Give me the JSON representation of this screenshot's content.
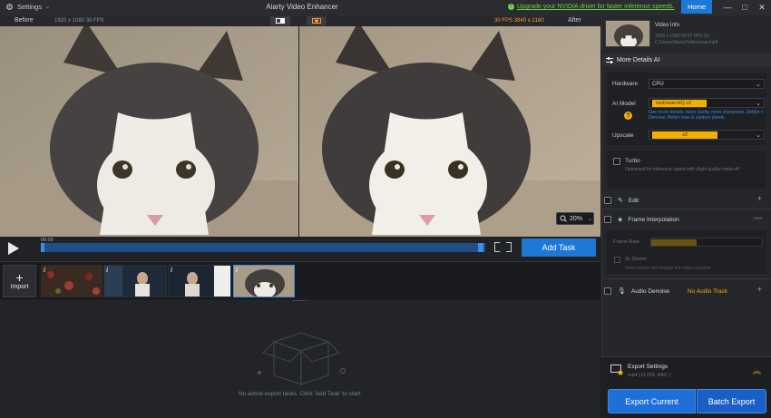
{
  "titlebar": {
    "settings_label": "Settings",
    "app_title": "Aiarty Video Enhancer",
    "upgrade_text": "Upgrade your NVIDIA driver for faster inference speeds.",
    "home_label": "Home",
    "minimize": "—",
    "maximize": "□",
    "close": "✕"
  },
  "compare": {
    "before_label": "Before",
    "before_meta": "1920 x 1080  30 FPS",
    "after_meta": "30 FPS  3840 x 2160",
    "after_label": "After",
    "zoom": "20%"
  },
  "playback": {
    "timecode": "00:00",
    "add_task_label": "Add Task"
  },
  "clips": {
    "import_label": "Import",
    "items": [
      {
        "badge": "i"
      },
      {
        "badge": "i"
      },
      {
        "badge": "i"
      },
      {
        "badge": "i"
      }
    ]
  },
  "tasks": {
    "empty_message": "No active export tasks. Click 'Add Task' to start."
  },
  "right_panel": {
    "video_info": {
      "title": "Video Info",
      "line1": "1920 x 1080  00:07  FPS 30",
      "line2": "C:\\Users\\Aiarty\\Videos\\cat.mp4"
    },
    "more_details": {
      "title": "More Details AI",
      "hardware_label": "Hardware",
      "hardware_value": "CPU",
      "model_label": "AI Model",
      "model_value": "moDetail-HQ  v2",
      "model_desc": "Gen more details, more clarity, more sharpness. Deblur + Denoise. Better man & outdoor plants.",
      "upscale_label": "Upscale",
      "upscale_value": "x2"
    },
    "turbo": {
      "title": "Turbo",
      "desc": "Optimized for inference speed with slight quality trade-off"
    },
    "edit_label": "Edit",
    "frame_interp": {
      "title": "Frame Interpolation",
      "frame_rate_label": "Frame Rate",
      "slow_title": "2x Slower",
      "slow_desc": "Slow motion will change the video duration"
    },
    "audio_denoise": {
      "title": "Audio Denoise",
      "status": "No Audio Track"
    },
    "export": {
      "title": "Export Settings",
      "sub": "mp4 | H.264, AAC |",
      "current_label": "Export Current",
      "batch_label": "Batch Export"
    }
  },
  "colors": {
    "accent": "#1e78d6",
    "warning": "#f4b000",
    "success": "#6fcf4b",
    "panel": "#25272b",
    "background": "#1e1f22"
  }
}
